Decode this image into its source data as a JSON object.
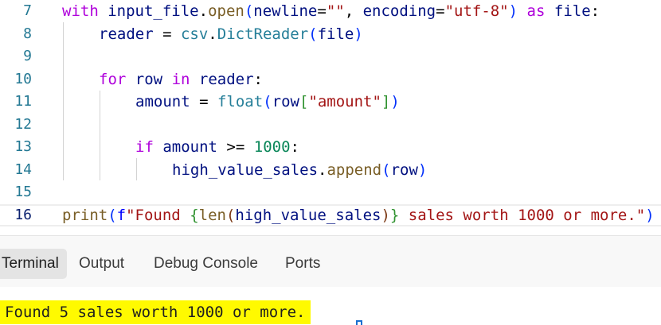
{
  "editor": {
    "lines": [
      {
        "num": "7",
        "indent": 0,
        "tokens": [
          {
            "t": "with",
            "c": "kw"
          },
          {
            "t": " "
          },
          {
            "t": "input_file",
            "c": "var"
          },
          {
            "t": "."
          },
          {
            "t": "open",
            "c": "fn"
          },
          {
            "t": "(",
            "c": "p1"
          },
          {
            "t": "newline",
            "c": "var"
          },
          {
            "t": "="
          },
          {
            "t": "\"\"",
            "c": "str"
          },
          {
            "t": ", "
          },
          {
            "t": "encoding",
            "c": "var"
          },
          {
            "t": "="
          },
          {
            "t": "\"utf-8\"",
            "c": "str"
          },
          {
            "t": ")",
            "c": "p1"
          },
          {
            "t": " "
          },
          {
            "t": "as",
            "c": "kw"
          },
          {
            "t": " "
          },
          {
            "t": "file",
            "c": "var"
          },
          {
            "t": ":"
          }
        ]
      },
      {
        "num": "8",
        "indent": 1,
        "tokens": [
          {
            "t": "reader",
            "c": "var"
          },
          {
            "t": " = "
          },
          {
            "t": "csv",
            "c": "cls"
          },
          {
            "t": "."
          },
          {
            "t": "DictReader",
            "c": "cls"
          },
          {
            "t": "(",
            "c": "p1"
          },
          {
            "t": "file",
            "c": "var"
          },
          {
            "t": ")",
            "c": "p1"
          }
        ]
      },
      {
        "num": "9",
        "indent": 0,
        "tokens": []
      },
      {
        "num": "10",
        "indent": 1,
        "tokens": [
          {
            "t": "for",
            "c": "kw"
          },
          {
            "t": " "
          },
          {
            "t": "row",
            "c": "var"
          },
          {
            "t": " "
          },
          {
            "t": "in",
            "c": "kw"
          },
          {
            "t": " "
          },
          {
            "t": "reader",
            "c": "var"
          },
          {
            "t": ":"
          }
        ]
      },
      {
        "num": "11",
        "indent": 2,
        "tokens": [
          {
            "t": "amount",
            "c": "var"
          },
          {
            "t": " = "
          },
          {
            "t": "float",
            "c": "cls"
          },
          {
            "t": "(",
            "c": "p1"
          },
          {
            "t": "row",
            "c": "var"
          },
          {
            "t": "[",
            "c": "p2"
          },
          {
            "t": "\"amount\"",
            "c": "str"
          },
          {
            "t": "]",
            "c": "p2"
          },
          {
            "t": ")",
            "c": "p1"
          }
        ]
      },
      {
        "num": "12",
        "indent": 0,
        "tokens": []
      },
      {
        "num": "13",
        "indent": 2,
        "tokens": [
          {
            "t": "if",
            "c": "kw"
          },
          {
            "t": " "
          },
          {
            "t": "amount",
            "c": "var"
          },
          {
            "t": " >= "
          },
          {
            "t": "1000",
            "c": "num"
          },
          {
            "t": ":"
          }
        ]
      },
      {
        "num": "14",
        "indent": 3,
        "tokens": [
          {
            "t": "high_value_sales",
            "c": "var"
          },
          {
            "t": "."
          },
          {
            "t": "append",
            "c": "fn"
          },
          {
            "t": "(",
            "c": "p1"
          },
          {
            "t": "row",
            "c": "var"
          },
          {
            "t": ")",
            "c": "p1"
          }
        ]
      },
      {
        "num": "15",
        "indent": 0,
        "tokens": []
      },
      {
        "num": "16",
        "indent": 0,
        "current": true,
        "tokens": [
          {
            "t": "print",
            "c": "bi"
          },
          {
            "t": "(",
            "c": "p1"
          },
          {
            "t": "f",
            "c": "sf"
          },
          {
            "t": "\"Found ",
            "c": "str"
          },
          {
            "t": "{",
            "c": "p2"
          },
          {
            "t": "len",
            "c": "bi"
          },
          {
            "t": "(",
            "c": "p3"
          },
          {
            "t": "high_value_sales",
            "c": "var"
          },
          {
            "t": ")",
            "c": "p3"
          },
          {
            "t": "}",
            "c": "p2"
          },
          {
            "t": " sales worth 1000 or more.\"",
            "c": "str"
          },
          {
            "t": ")",
            "c": "p1"
          }
        ]
      }
    ]
  },
  "panel": {
    "tabs": [
      {
        "label": "Terminal",
        "active": true
      },
      {
        "label": "Output",
        "active": false
      },
      {
        "label": "Debug Console",
        "active": false
      },
      {
        "label": "Ports",
        "active": false
      }
    ],
    "terminal_output": "Found 5 sales worth 1000 or more.",
    "highlight_color": "#fffa00"
  }
}
